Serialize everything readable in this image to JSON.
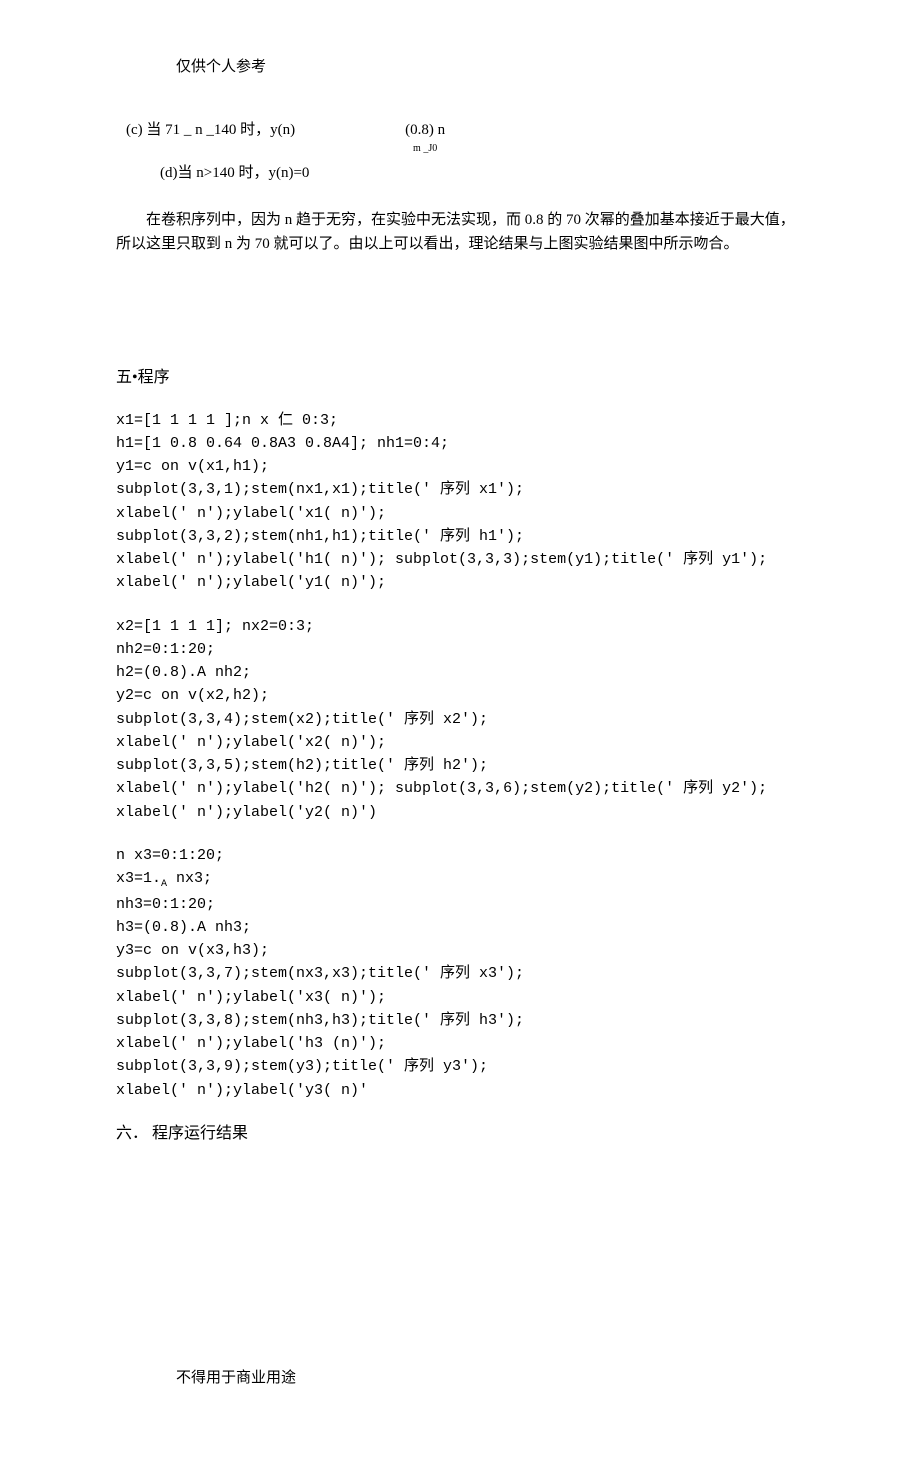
{
  "header": "仅供个人参考",
  "eq_c_left": "(c) 当 71 _ n _140 时，y(n)",
  "eq_c_right_top": "(0.8) n",
  "eq_c_right_sub": "m _J0",
  "eq_d": "(d)当 n>140 时，y(n)=0",
  "paragraph": "在卷积序列中，因为 n 趋于无穷，在实验中无法实现，而      0.8 的 70 次幂的叠加基本接近于最大值，所以这里只取到    n 为 70 就可以了。由以上可以看出，理论结果与上图实验结果图中所示吻合。",
  "sec5_title": "五•程序",
  "code1": [
    "x1=[1 1 1 1 ];n x 仁 0:3;",
    "h1=[1 0.8 0.64 0.8A3 0.8A4]; nh1=0:4;",
    "y1=c on v(x1,h1);",
    "subplot(3,3,1);stem(nx1,x1);title('            序列 x1');",
    "xlabel(' n');ylabel('x1( n)');",
    "subplot(3,3,2);stem(nh1,h1);title('            序列 h1');",
    "xlabel(' n');ylabel('h1( n)'); subplot(3,3,3);stem(y1);title('   序列 y1');",
    "xlabel(' n');ylabel('y1( n)');"
  ],
  "code2": [
    "x2=[1 1 1 1]; nx2=0:3;",
    "nh2=0:1:20;",
    "h2=(0.8).A nh2;",
    "y2=c on v(x2,h2);",
    "subplot(3,3,4);stem(x2);title('            序列 x2');",
    "xlabel(' n');ylabel('x2( n)');",
    "subplot(3,3,5);stem(h2);title('            序列 h2');",
    "xlabel(' n');ylabel('h2( n)'); subplot(3,3,6);stem(y2);title('   序列 y2');",
    "xlabel(' n');ylabel('y2( n)')"
  ],
  "code3": [
    "n x3=0:1:20;",
    "x3=1.A nx3;",
    "nh3=0:1:20;",
    "h3=(0.8).A nh3;",
    "y3=c on v(x3,h3);",
    "subplot(3,3,7);stem(nx3,x3);title('            序列 x3');",
    "xlabel(' n');ylabel('x3( n)');",
    "subplot(3,3,8);stem(nh3,h3);title('            序列 h3');",
    "xlabel(' n');ylabel('h3 (n)');",
    "subplot(3,3,9);stem(y3);title('            序列 y3');",
    "xlabel(' n');ylabel('y3( n)'"
  ],
  "sec6_title": "六．  程序运行结果",
  "footer": "不得用于商业用途",
  "tiny": ""
}
